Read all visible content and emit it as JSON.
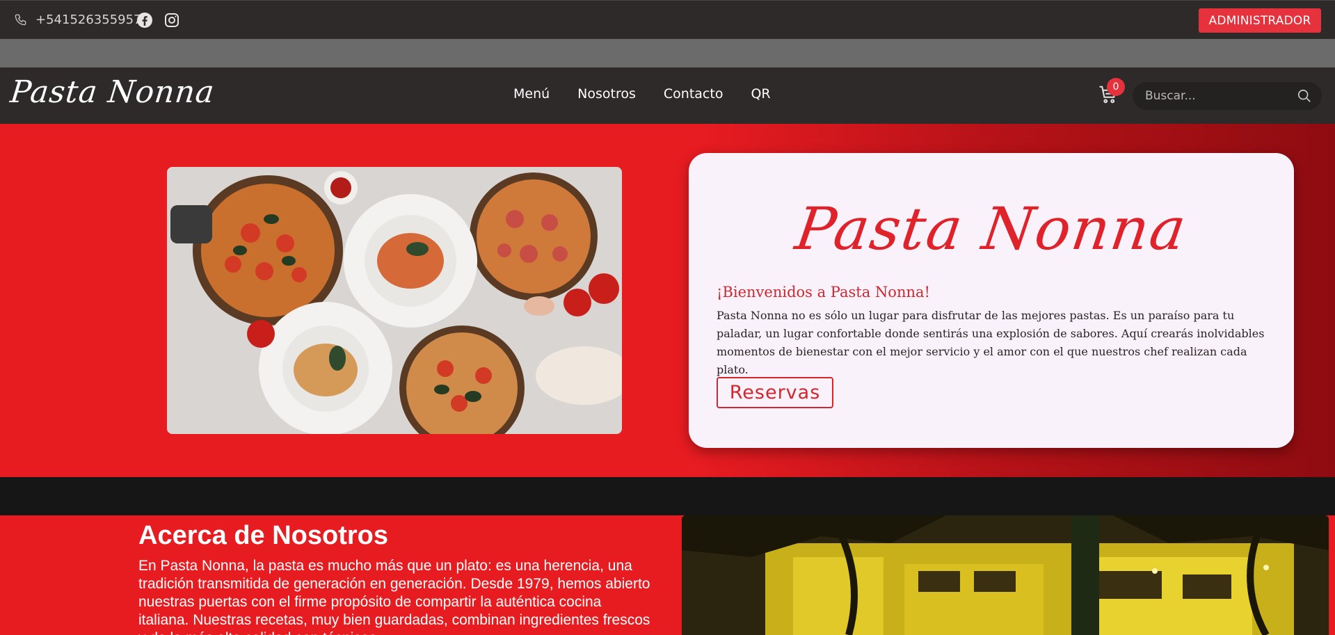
{
  "topbar": {
    "phone": "+541526355957",
    "admin_label": "ADMINISTRADOR"
  },
  "nav": {
    "logo": "Pasta Nonna",
    "links": [
      "Menú",
      "Nosotros",
      "Contacto",
      "QR"
    ],
    "cart_count": "0",
    "search_placeholder": "Buscar..."
  },
  "hero": {
    "card_logo": "Pasta Nonna",
    "welcome": "¡Bienvenidos a Pasta Nonna!",
    "description": "Pasta Nonna no es sólo un lugar para disfrutar de las mejores pastas. Es un paraíso para tu paladar, un lugar confortable donde sentirás una explosión de sabores. Aquí crearás inolvidables momentos de bienestar con el mejor servicio y el amor con el que nuestros chef realizan cada plato.",
    "reserve_label": "Reservas"
  },
  "about": {
    "title": "Acerca de Nosotros",
    "text": "En Pasta Nonna, la pasta es mucho más que un plato: es una herencia, una tradición transmitida de generación en generación. Desde 1979, hemos abierto nuestras puertas con el firme propósito de compartir la auténtica cocina italiana. Nuestras recetas, muy bien guardadas, combinan ingredientes frescos y de la más alta calidad con técnicas"
  },
  "colors": {
    "accent": "#e71c21",
    "admin_button": "#e5323c",
    "dark_bar": "#2f2a2a"
  }
}
